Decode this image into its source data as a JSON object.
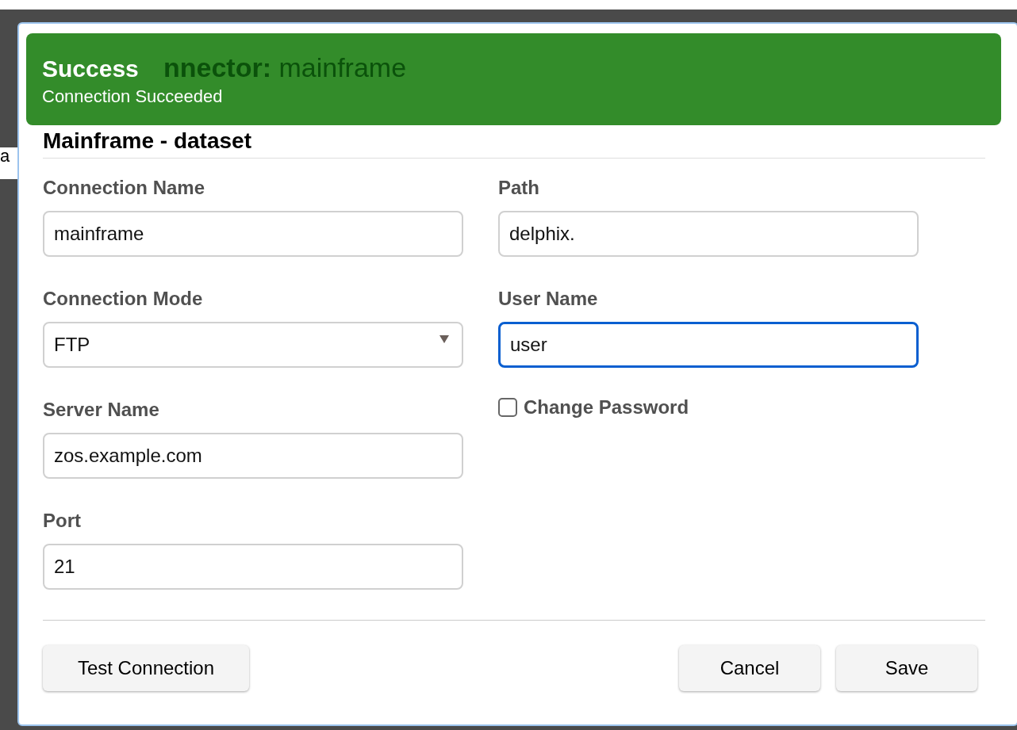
{
  "backdrop": {
    "text": "a"
  },
  "dialog": {
    "title_prefix": "nnector:",
    "title_name": "mainframe",
    "subtitle": "Mainframe - dataset"
  },
  "notification": {
    "title": "Success",
    "message": "Connection Succeeded"
  },
  "left_fields": [
    {
      "kind": "text",
      "label": "Connection Name",
      "value": "mainframe",
      "focused": false
    },
    {
      "kind": "select",
      "label": "Connection Mode",
      "value": "FTP",
      "focused": false
    },
    {
      "kind": "text",
      "label": "Server Name",
      "value": "zos.example.com",
      "focused": false
    },
    {
      "kind": "text",
      "label": "Port",
      "value": "21",
      "focused": false
    }
  ],
  "right_fields": [
    {
      "kind": "text",
      "label": "Path",
      "value": "delphix.",
      "focused": false
    },
    {
      "kind": "text",
      "label": "User Name",
      "value": "user",
      "focused": true
    },
    {
      "kind": "checkbox",
      "label": "Change Password",
      "checked": false
    }
  ],
  "footer": {
    "left_buttons": [
      "Test Connection"
    ],
    "right_buttons": [
      "Cancel",
      "Save"
    ]
  }
}
